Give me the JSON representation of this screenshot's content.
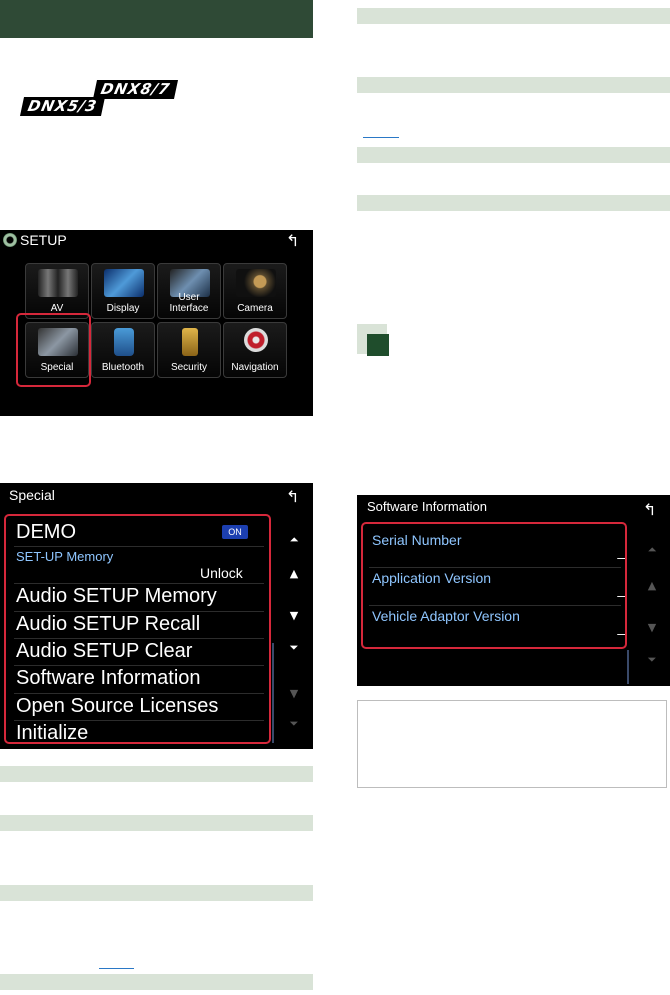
{
  "badges": {
    "dnx87": "DNX8/7",
    "dnx53": "DNX5/3"
  },
  "setup_screen": {
    "title": "SETUP",
    "tiles": [
      {
        "label": "AV"
      },
      {
        "label": "Display"
      },
      {
        "label": "User Interface"
      },
      {
        "label": "Camera"
      },
      {
        "label": "Special"
      },
      {
        "label": "Bluetooth"
      },
      {
        "label": "Security"
      },
      {
        "label": "Navigation"
      }
    ]
  },
  "special_screen": {
    "title": "Special",
    "items": {
      "demo": "DEMO",
      "demo_state": "ON",
      "setup_memory": "SET-UP Memory",
      "setup_memory_state": "Unlock",
      "audio_memory": "Audio SETUP Memory",
      "audio_recall": "Audio SETUP Recall",
      "audio_clear": "Audio SETUP Clear",
      "software_info": "Software Information",
      "open_source": "Open Source Licenses",
      "initialize": "Initialize"
    }
  },
  "software_screen": {
    "title": "Software Information",
    "rows": [
      {
        "label": "Serial Number",
        "value": "–"
      },
      {
        "label": "Application Version",
        "value": "–"
      },
      {
        "label": "Vehicle Adaptor Version",
        "value": "–"
      }
    ]
  },
  "colors": {
    "header_green": "#2f4a36",
    "band": "#d9e3d7",
    "highlight_red": "#d6283b"
  }
}
